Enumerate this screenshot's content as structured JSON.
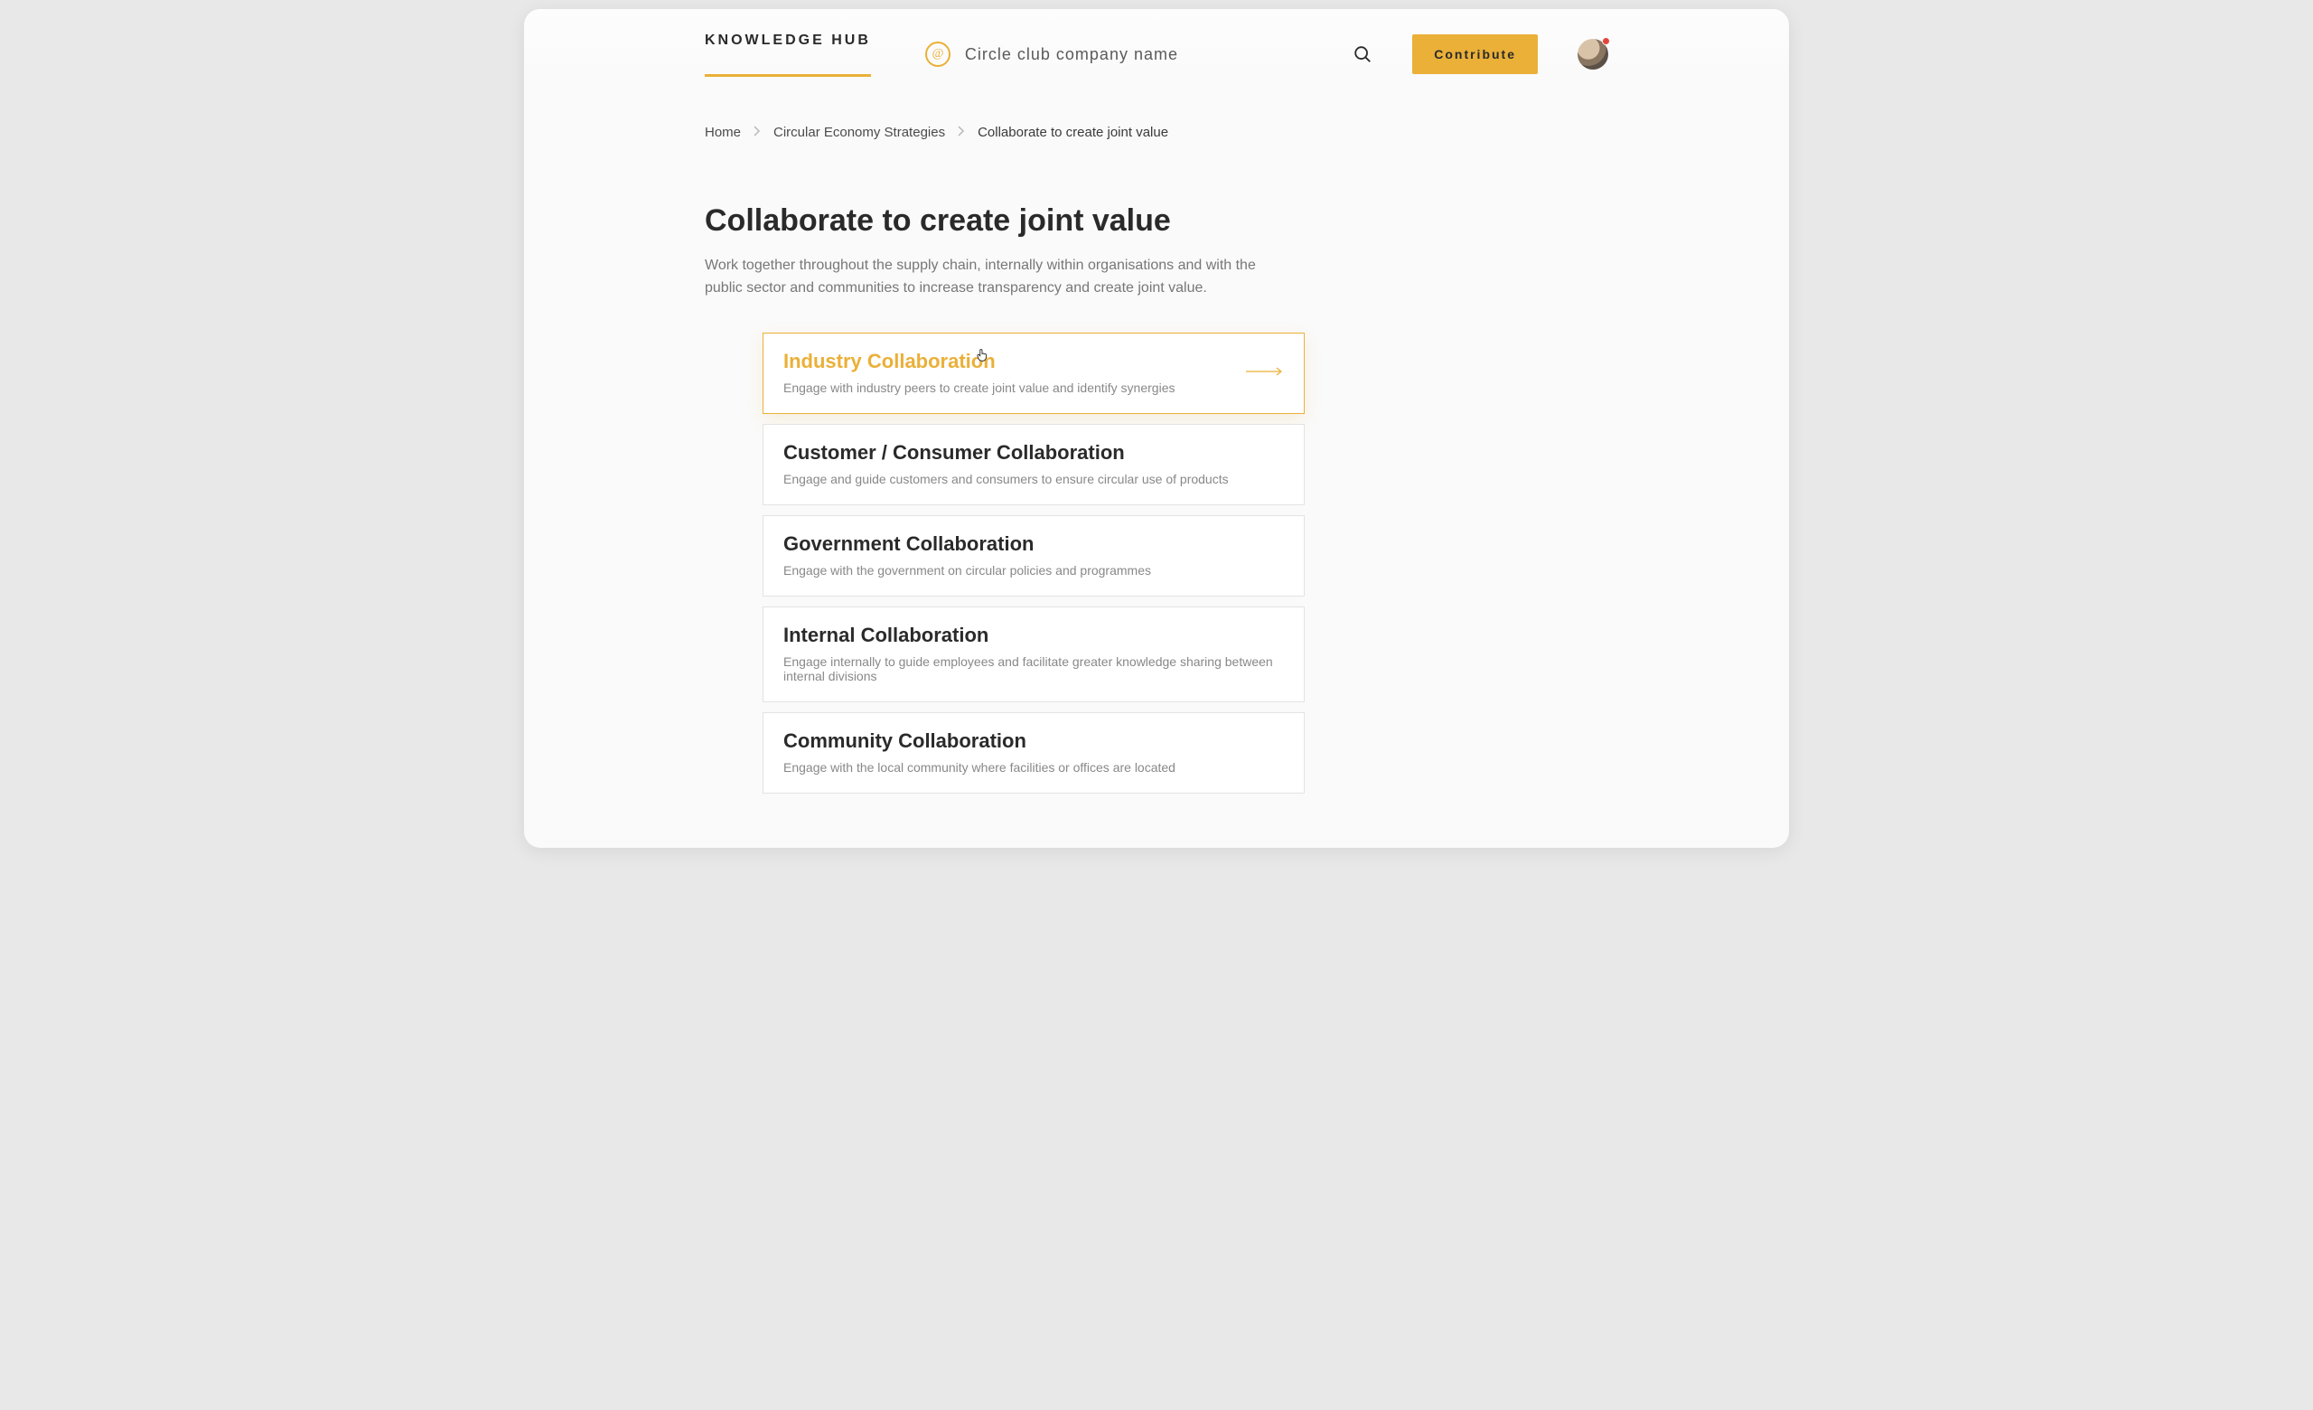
{
  "header": {
    "brand": "KNOWLEDGE HUB",
    "company_name": "Circle club company name",
    "contribute_label": "Contribute",
    "logo_glyph": "@"
  },
  "breadcrumb": {
    "items": [
      {
        "label": "Home",
        "current": false
      },
      {
        "label": "Circular Economy Strategies",
        "current": false
      },
      {
        "label": "Collaborate to create joint value",
        "current": true
      }
    ]
  },
  "page": {
    "title": "Collaborate to create joint value",
    "description": "Work together throughout the supply chain, internally within organisations and with the public sector and communities to increase transparency and create joint value."
  },
  "cards": [
    {
      "title": "Industry Collaboration",
      "description": "Engage with industry peers to create joint value and identify synergies",
      "active": true
    },
    {
      "title": "Customer / Consumer Collaboration",
      "description": "Engage and guide customers and consumers to ensure circular use of products",
      "active": false
    },
    {
      "title": "Government Collaboration",
      "description": "Engage with the government on circular policies and programmes",
      "active": false
    },
    {
      "title": "Internal Collaboration",
      "description": "Engage internally to guide employees and facilitate greater knowledge sharing between internal divisions",
      "active": false
    },
    {
      "title": "Community Collaboration",
      "description": "Engage with the local community where facilities or offices are located",
      "active": false
    }
  ],
  "colors": {
    "accent": "#eab038",
    "text_primary": "#2a2a2a",
    "text_muted": "#777"
  }
}
